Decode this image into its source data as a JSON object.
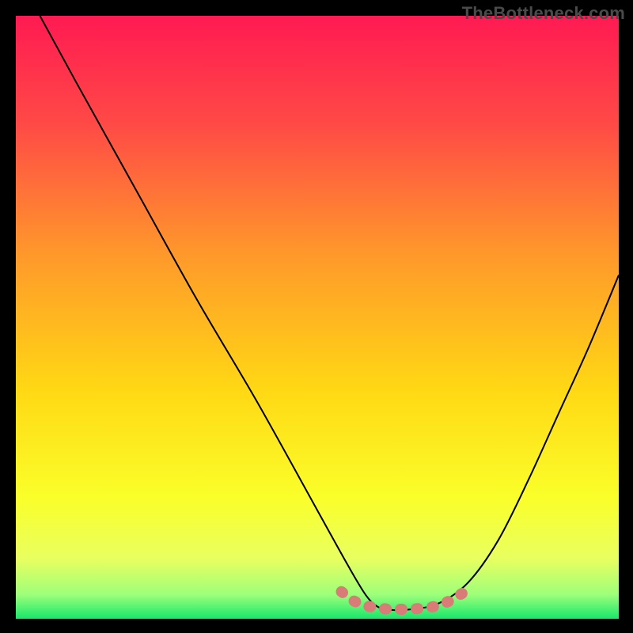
{
  "watermark": "TheBottleneck.com",
  "chart_data": {
    "type": "line",
    "title": "",
    "xlabel": "",
    "ylabel": "",
    "xlim": [
      0,
      100
    ],
    "ylim": [
      0,
      100
    ],
    "series": [
      {
        "name": "curve",
        "color": "#000000",
        "x": [
          4,
          10,
          20,
          30,
          40,
          50,
          55,
          58,
          60,
          62,
          65,
          70,
          75,
          80,
          85,
          90,
          95,
          100
        ],
        "values": [
          100,
          89,
          71,
          53,
          36,
          18,
          9,
          4,
          2,
          1.5,
          1.5,
          2.5,
          6,
          13,
          23,
          34,
          45,
          57
        ]
      },
      {
        "name": "highlight-band",
        "color": "#d97c78",
        "x": [
          54,
          56,
          58,
          60,
          62,
          65,
          68,
          70,
          72,
          74
        ],
        "values": [
          4.5,
          3.0,
          2.2,
          1.8,
          1.6,
          1.6,
          1.8,
          2.2,
          3.0,
          4.2
        ]
      }
    ],
    "background_gradient": {
      "stops": [
        {
          "offset": 0.0,
          "color": "#ff1a52"
        },
        {
          "offset": 0.18,
          "color": "#ff4a46"
        },
        {
          "offset": 0.4,
          "color": "#ff9a2a"
        },
        {
          "offset": 0.62,
          "color": "#ffd814"
        },
        {
          "offset": 0.8,
          "color": "#faff2a"
        },
        {
          "offset": 0.9,
          "color": "#e8ff60"
        },
        {
          "offset": 0.96,
          "color": "#9dff7a"
        },
        {
          "offset": 1.0,
          "color": "#17e86b"
        }
      ]
    }
  }
}
